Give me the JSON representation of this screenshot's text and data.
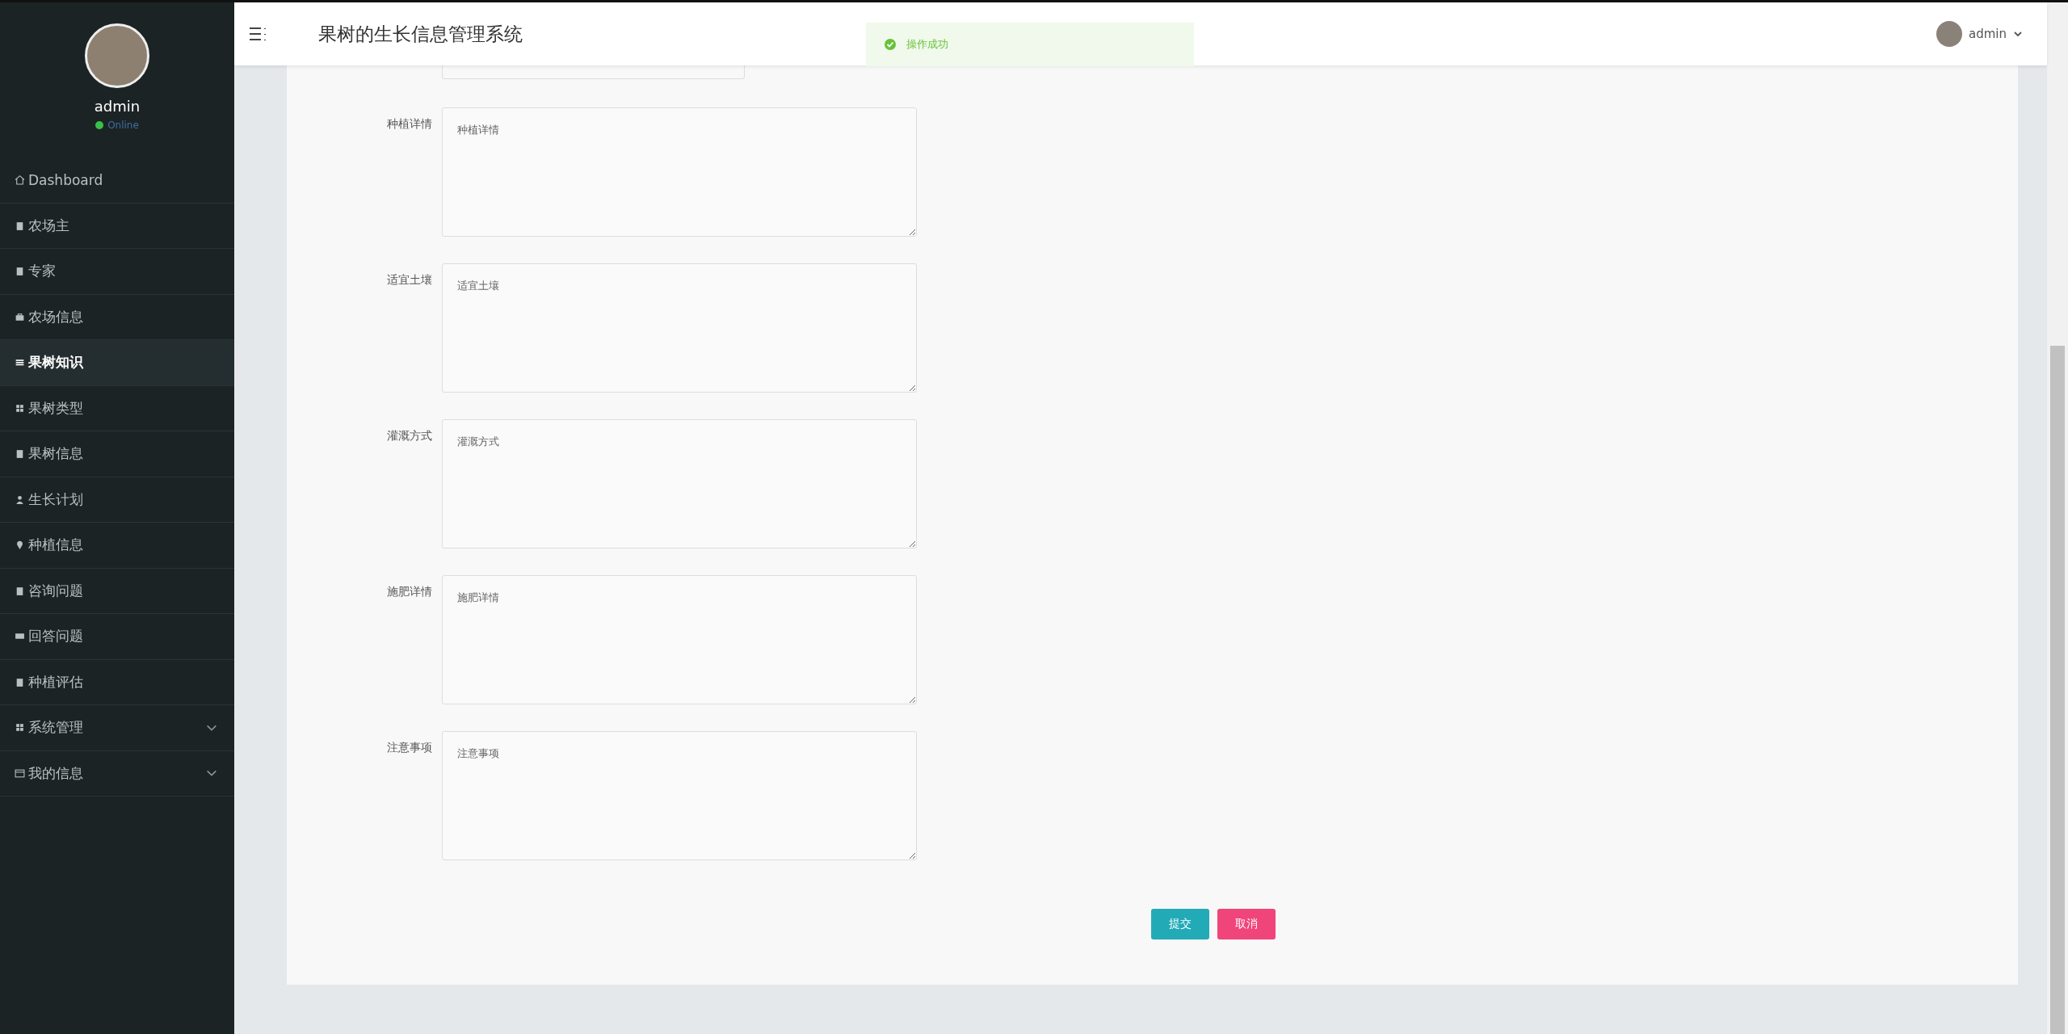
{
  "sidebar": {
    "user": {
      "name": "admin",
      "status": "Online"
    },
    "items": [
      {
        "label": "Dashboard",
        "selected": false,
        "expandable": false
      },
      {
        "label": "农场主",
        "selected": false,
        "expandable": false
      },
      {
        "label": "专家",
        "selected": false,
        "expandable": false
      },
      {
        "label": "农场信息",
        "selected": false,
        "expandable": false
      },
      {
        "label": "果树知识",
        "selected": true,
        "expandable": false
      },
      {
        "label": "果树类型",
        "selected": false,
        "expandable": false
      },
      {
        "label": "果树信息",
        "selected": false,
        "expandable": false
      },
      {
        "label": "生长计划",
        "selected": false,
        "expandable": false
      },
      {
        "label": "种植信息",
        "selected": false,
        "expandable": false
      },
      {
        "label": "咨询问题",
        "selected": false,
        "expandable": false
      },
      {
        "label": "回答问题",
        "selected": false,
        "expandable": false
      },
      {
        "label": "种植评估",
        "selected": false,
        "expandable": false
      },
      {
        "label": "系统管理",
        "selected": false,
        "expandable": true
      },
      {
        "label": "我的信息",
        "selected": false,
        "expandable": true
      }
    ]
  },
  "header": {
    "title": "果树的生长信息管理系统",
    "user": "admin"
  },
  "toast": {
    "message": "操作成功"
  },
  "form": {
    "fields": [
      {
        "label": "种植详情",
        "placeholder": "种植详情"
      },
      {
        "label": "适宜土壤",
        "placeholder": "适宜土壤"
      },
      {
        "label": "灌溉方式",
        "placeholder": "灌溉方式"
      },
      {
        "label": "施肥详情",
        "placeholder": "施肥详情"
      },
      {
        "label": "注意事项",
        "placeholder": "注意事项"
      }
    ],
    "buttons": [
      {
        "label": "提交",
        "kind": "primary"
      },
      {
        "label": "取消",
        "kind": "danger"
      }
    ]
  }
}
